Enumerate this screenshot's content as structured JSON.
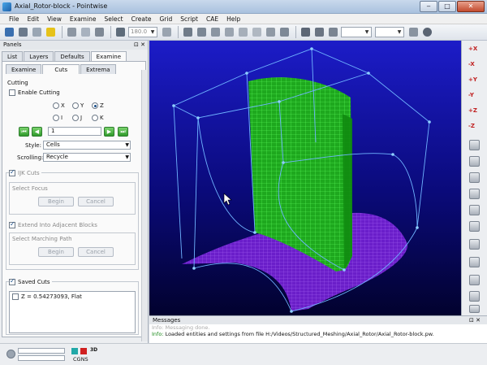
{
  "window": {
    "title": "Axial_Rotor-block - Pointwise"
  },
  "menu": [
    "File",
    "Edit",
    "View",
    "Examine",
    "Select",
    "Create",
    "Grid",
    "Script",
    "CAE",
    "Help"
  ],
  "toolbar": {
    "angle_value": "180.0"
  },
  "panels": {
    "title": "Panels",
    "tabs": [
      "List",
      "Layers",
      "Defaults",
      "Examine"
    ],
    "active_tab": "Examine",
    "sub_tabs": [
      "Examine",
      "Cuts",
      "Extrema"
    ],
    "active_sub_tab": "Cuts",
    "cutting": {
      "section_label": "Cutting",
      "enable_label": "Enable Cutting",
      "enabled": false,
      "axis_options": [
        "X",
        "Y",
        "Z"
      ],
      "axis_selected": "Z",
      "index_options": [
        "I",
        "J",
        "K"
      ],
      "index_value": "1",
      "style_label": "Style:",
      "style_value": "Cells",
      "scrolling_label": "Scrolling:",
      "scrolling_value": "Recycle"
    },
    "ijk": {
      "label": "IJK Cuts",
      "select_focus_label": "Select Focus",
      "begin_label": "Begin",
      "cancel_label": "Cancel",
      "extend_label": "Extend Into Adjacent Blocks",
      "select_path_label": "Select Marching Path",
      "begin2_label": "Begin",
      "cancel2_label": "Cancel"
    },
    "saved": {
      "label": "Saved Cuts",
      "items": [
        "Z = 0.54273093, Flat"
      ]
    }
  },
  "right_toolbar": {
    "axes": [
      "+X",
      "-X",
      "+Y",
      "-Y",
      "+Z",
      "-Z"
    ]
  },
  "messages": {
    "title": "Messages",
    "line1": "Info: Messaging done.",
    "line2_prefix": "Info:",
    "line2": "Loaded entities and settings from file H:/Videos/Structured_Meshing/Axial_Rotor/Axial_Rotor-block.pw."
  },
  "status": {
    "solver": "CGNS",
    "mode": "3D"
  },
  "colors": {
    "viewport_top": "#1c1cc8",
    "mesh_green": "#2fd22f",
    "mesh_purple": "#8a2be2",
    "frame_lines": "#6fb4ff"
  }
}
